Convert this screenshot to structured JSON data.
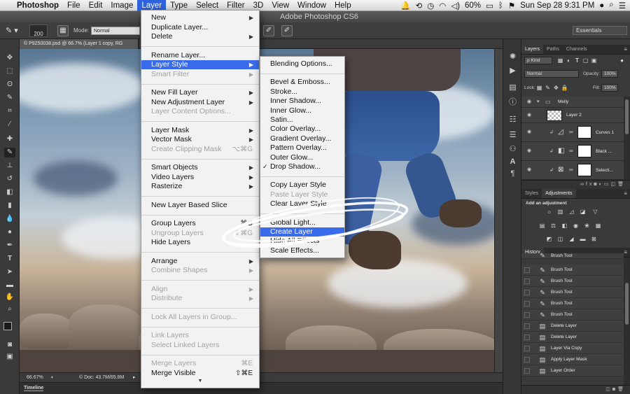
{
  "menubar": {
    "apple": "",
    "app_name": "Photoshop",
    "items": [
      "File",
      "Edit",
      "Image",
      "Layer",
      "Type",
      "Select",
      "Filter",
      "3D",
      "View",
      "Window",
      "Help"
    ],
    "active_item": "Layer",
    "battery": "60%",
    "datetime": "Sun Sep 28  9:31 PM"
  },
  "window": {
    "title": "Adobe Photoshop CS6"
  },
  "options_bar": {
    "brush_size": "200",
    "mode_label": "Mode:",
    "mode_value": "Normal",
    "workspace": "Essentials"
  },
  "document": {
    "tab": "© P9250038.psd @ 66.7% (Layer 1 copy, RG",
    "zoom": "66.67%",
    "doc_size": "© Doc: 43.7M/65.8M"
  },
  "timeline_label": "Timeline",
  "layer_menu": {
    "items": [
      {
        "label": "New",
        "submenu": true
      },
      {
        "label": "Duplicate Layer..."
      },
      {
        "label": "Delete",
        "submenu": true
      },
      {
        "sep": true
      },
      {
        "label": "Rename Layer..."
      },
      {
        "label": "Layer Style",
        "submenu": true,
        "highlight": true
      },
      {
        "label": "Smart Filter",
        "submenu": true,
        "disabled": true
      },
      {
        "sep": true
      },
      {
        "label": "New Fill Layer",
        "submenu": true
      },
      {
        "label": "New Adjustment Layer",
        "submenu": true
      },
      {
        "label": "Layer Content Options...",
        "disabled": true
      },
      {
        "sep": true
      },
      {
        "label": "Layer Mask",
        "submenu": true
      },
      {
        "label": "Vector Mask",
        "submenu": true
      },
      {
        "label": "Create Clipping Mask",
        "disabled": true,
        "shortcut": "⌥⌘G"
      },
      {
        "sep": true
      },
      {
        "label": "Smart Objects",
        "submenu": true
      },
      {
        "label": "Video Layers",
        "submenu": true
      },
      {
        "label": "Rasterize",
        "submenu": true
      },
      {
        "sep": true
      },
      {
        "label": "New Layer Based Slice"
      },
      {
        "sep": true
      },
      {
        "label": "Group Layers",
        "shortcut": "⌘G"
      },
      {
        "label": "Ungroup Layers",
        "disabled": true,
        "shortcut": "⇧⌘G"
      },
      {
        "label": "Hide Layers"
      },
      {
        "sep": true
      },
      {
        "label": "Arrange",
        "submenu": true
      },
      {
        "label": "Combine Shapes",
        "submenu": true,
        "disabled": true
      },
      {
        "sep": true
      },
      {
        "label": "Align",
        "submenu": true,
        "disabled": true
      },
      {
        "label": "Distribute",
        "submenu": true,
        "disabled": true
      },
      {
        "sep": true
      },
      {
        "label": "Lock All Layers in Group...",
        "disabled": true
      },
      {
        "sep": true
      },
      {
        "label": "Link Layers",
        "disabled": true
      },
      {
        "label": "Select Linked Layers",
        "disabled": true
      },
      {
        "sep": true
      },
      {
        "label": "Merge Layers",
        "disabled": true,
        "shortcut": "⌘E"
      },
      {
        "label": "Merge Visible",
        "shortcut": "⇧⌘E"
      }
    ],
    "more_indicator": "▼"
  },
  "style_submenu": {
    "items": [
      {
        "label": "Blending Options..."
      },
      {
        "sep": true
      },
      {
        "label": "Bevel & Emboss..."
      },
      {
        "label": "Stroke..."
      },
      {
        "label": "Inner Shadow..."
      },
      {
        "label": "Inner Glow..."
      },
      {
        "label": "Satin..."
      },
      {
        "label": "Color Overlay..."
      },
      {
        "label": "Gradient Overlay..."
      },
      {
        "label": "Pattern Overlay..."
      },
      {
        "label": "Outer Glow..."
      },
      {
        "label": "Drop Shadow...",
        "checked": true
      },
      {
        "sep": true
      },
      {
        "label": "Copy Layer Style"
      },
      {
        "label": "Paste Layer Style",
        "disabled": true
      },
      {
        "label": "Clear Layer Style"
      },
      {
        "sep": true
      },
      {
        "label": "Global Light..."
      },
      {
        "label": "Create Layer",
        "highlight": true
      },
      {
        "label": "Hide All Effects"
      },
      {
        "label": "Scale Effects..."
      }
    ]
  },
  "layers_panel": {
    "tabs": [
      "Layers",
      "Paths",
      "Channels"
    ],
    "active_tab": "Layers",
    "kind_filter": "ρ Kind",
    "blend_mode": "Normal",
    "opacity_label": "Opacity:",
    "opacity_value": "100%",
    "lock_label": "Lock:",
    "fill_label": "Fill:",
    "fill_value": "100%",
    "layers": [
      {
        "name": "Melly",
        "type": "group"
      },
      {
        "name": "Layer 2",
        "type": "pixel"
      },
      {
        "name": "Curves 1",
        "type": "adjustment"
      },
      {
        "name": "Black ...",
        "type": "adjustment"
      },
      {
        "name": "Selecti...",
        "type": "adjustment"
      }
    ]
  },
  "adjustments_panel": {
    "tabs": [
      "Styles",
      "Adjustments"
    ],
    "active_tab": "Adjustments",
    "heading": "Add an adjustment"
  },
  "history_panel": {
    "tab": "History",
    "items": [
      "Brush Tool",
      "Brush Tool",
      "Brush Tool",
      "Brush Tool",
      "Brush Tool",
      "Brush Tool",
      "Delete Layer",
      "Delete Layer",
      "Layer Via Copy",
      "Apply Layer Mask",
      "Layer Order"
    ]
  },
  "colors": {
    "accent": "#3a6bea",
    "menubar_active": "#2f62de",
    "panel_bg": "#3a3a3a"
  }
}
